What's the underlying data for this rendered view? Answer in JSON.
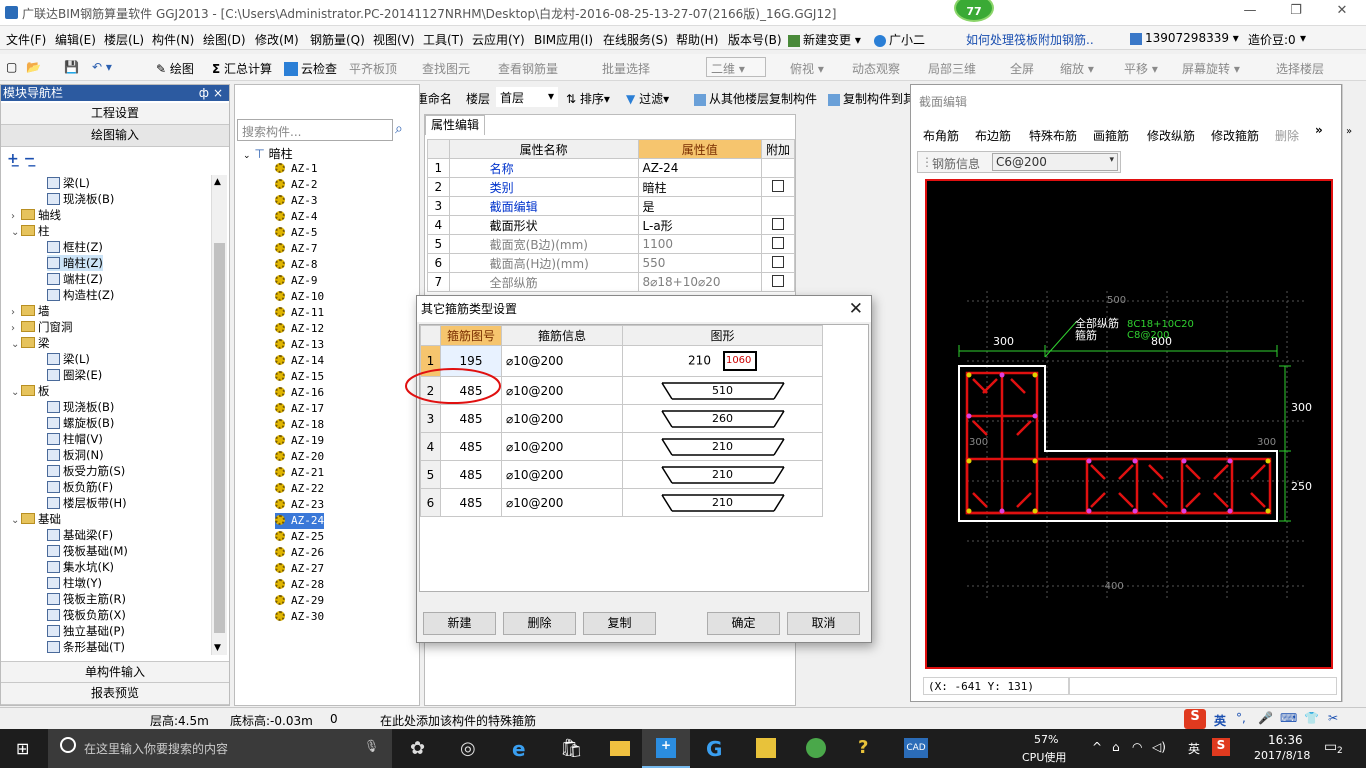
{
  "app": {
    "title": "广联达BIM钢筋算量软件 GGJ2013 - [C:\\Users\\Administrator.PC-20141127NRHM\\Desktop\\白龙村-2016-08-25-13-27-07(2166版)_16G.GGJ12]",
    "badge": "77"
  },
  "menu": [
    "文件(F)",
    "编辑(E)",
    "楼层(L)",
    "构件(N)",
    "绘图(D)",
    "修改(M)",
    "钢筋量(Q)",
    "视图(V)",
    "工具(T)",
    "云应用(Y)",
    "BIM应用(I)",
    "在线服务(S)",
    "帮助(H)",
    "版本号(B)",
    "新建变更",
    "广小二",
    "如何处理筏板附加钢筋..",
    "13907298339",
    "造价豆:0"
  ],
  "toolbar1": {
    "draw": "绘图",
    "sum": "汇总计算",
    "cloud_check": "云检查",
    "flat_top": "平齐板顶",
    "find": "查找图元",
    "view_steel": "查看钢筋量",
    "batch": "批量选择",
    "view_mode": "二维",
    "top_view": "俯视",
    "dynamic": "动态观察",
    "local3d": "局部三维",
    "fullscreen": "全屏",
    "zoom": "缩放",
    "pan": "平移",
    "rotate": "屏幕旋转",
    "select_floor": "选择楼层"
  },
  "toolbar2": {
    "new": "新建",
    "delete": "删除",
    "copy": "复制",
    "rename": "重命名",
    "floor_label": "楼层",
    "floor_value": "首层",
    "sort": "排序",
    "filter": "过滤",
    "copy_from_floor": "从其他楼层复制构件",
    "copy_to": "复制构件到其"
  },
  "left": {
    "header": "模块导航栏",
    "pin": "ф",
    "close": "×",
    "eng_settings": "工程设置",
    "draw_input": "绘图输入",
    "single_input": "单构件输入",
    "report": "报表预览",
    "tree": [
      {
        "t": "梁(L)",
        "lvl": 3,
        "icon": "beam"
      },
      {
        "t": "现浇板(B)",
        "lvl": 3,
        "icon": "slab"
      },
      {
        "t": "轴线",
        "lvl": 1,
        "icon": "folder",
        "exp": "›"
      },
      {
        "t": "柱",
        "lvl": 1,
        "icon": "folder",
        "exp": "⌄"
      },
      {
        "t": "框柱(Z)",
        "lvl": 3,
        "icon": "col"
      },
      {
        "t": "暗柱(Z)",
        "lvl": 3,
        "icon": "col",
        "sel": true
      },
      {
        "t": "端柱(Z)",
        "lvl": 3,
        "icon": "col"
      },
      {
        "t": "构造柱(Z)",
        "lvl": 3,
        "icon": "col"
      },
      {
        "t": "墙",
        "lvl": 1,
        "icon": "folder",
        "exp": "›"
      },
      {
        "t": "门窗洞",
        "lvl": 1,
        "icon": "folder",
        "exp": "›"
      },
      {
        "t": "梁",
        "lvl": 1,
        "icon": "folder",
        "exp": "⌄"
      },
      {
        "t": "梁(L)",
        "lvl": 3,
        "icon": "beam"
      },
      {
        "t": "圈梁(E)",
        "lvl": 3,
        "icon": "beam"
      },
      {
        "t": "板",
        "lvl": 1,
        "icon": "folder",
        "exp": "⌄"
      },
      {
        "t": "现浇板(B)",
        "lvl": 3,
        "icon": "slab"
      },
      {
        "t": "螺旋板(B)",
        "lvl": 3,
        "icon": "slab"
      },
      {
        "t": "柱帽(V)",
        "lvl": 3,
        "icon": "slab"
      },
      {
        "t": "板洞(N)",
        "lvl": 3,
        "icon": "slab"
      },
      {
        "t": "板受力筋(S)",
        "lvl": 3,
        "icon": "slab"
      },
      {
        "t": "板负筋(F)",
        "lvl": 3,
        "icon": "slab"
      },
      {
        "t": "楼层板带(H)",
        "lvl": 3,
        "icon": "slab"
      },
      {
        "t": "基础",
        "lvl": 1,
        "icon": "folder",
        "exp": "⌄"
      },
      {
        "t": "基础梁(F)",
        "lvl": 3,
        "icon": "beam"
      },
      {
        "t": "筏板基础(M)",
        "lvl": 3,
        "icon": "slab"
      },
      {
        "t": "集水坑(K)",
        "lvl": 3,
        "icon": "slab"
      },
      {
        "t": "柱墩(Y)",
        "lvl": 3,
        "icon": "col"
      },
      {
        "t": "筏板主筋(R)",
        "lvl": 3,
        "icon": "slab"
      },
      {
        "t": "筏板负筋(X)",
        "lvl": 3,
        "icon": "slab"
      },
      {
        "t": "独立基础(P)",
        "lvl": 3,
        "icon": "slab"
      },
      {
        "t": "条形基础(T)",
        "lvl": 3,
        "icon": "slab"
      }
    ]
  },
  "mid": {
    "search_placeholder": "搜索构件...",
    "root": "暗柱",
    "items": [
      "AZ-1",
      "AZ-2",
      "AZ-3",
      "AZ-4",
      "AZ-5",
      "AZ-7",
      "AZ-8",
      "AZ-9",
      "AZ-10",
      "AZ-11",
      "AZ-12",
      "AZ-13",
      "AZ-14",
      "AZ-15",
      "AZ-16",
      "AZ-17",
      "AZ-18",
      "AZ-19",
      "AZ-20",
      "AZ-21",
      "AZ-22",
      "AZ-23",
      "AZ-24",
      "AZ-25",
      "AZ-26",
      "AZ-27",
      "AZ-28",
      "AZ-29",
      "AZ-30"
    ],
    "selected": "AZ-24"
  },
  "props": {
    "tab": "属性编辑",
    "h_name": "属性名称",
    "h_value": "属性值",
    "h_extra": "附加",
    "rows": [
      {
        "n": "1",
        "name": "名称",
        "val": "AZ-24",
        "color": "blue",
        "chk": false
      },
      {
        "n": "2",
        "name": "类别",
        "val": "暗柱",
        "color": "blue",
        "chk": true
      },
      {
        "n": "3",
        "name": "截面编辑",
        "val": "是",
        "color": "blue",
        "chk": false
      },
      {
        "n": "4",
        "name": "截面形状",
        "val": "L-a形",
        "color": "normal",
        "chk": true
      },
      {
        "n": "5",
        "name": "截面宽(B边)(mm)",
        "val": "1100",
        "color": "gray",
        "chk": true
      },
      {
        "n": "6",
        "name": "截面高(H边)(mm)",
        "val": "550",
        "color": "gray",
        "chk": true
      },
      {
        "n": "7",
        "name": "全部纵筋",
        "val": "8⌀18+10⌀20",
        "color": "gray",
        "chk": true
      }
    ]
  },
  "dialog": {
    "title": "其它箍筋类型设置",
    "h_no": "箍筋图号",
    "h_info": "箍筋信息",
    "h_shape": "图形",
    "rows": [
      {
        "n": "1",
        "no": "195",
        "info": "⌀10@200",
        "a": "210",
        "b": "1060"
      },
      {
        "n": "2",
        "no": "485",
        "info": "⌀10@200",
        "a": "510"
      },
      {
        "n": "3",
        "no": "485",
        "info": "⌀10@200",
        "a": "260"
      },
      {
        "n": "4",
        "no": "485",
        "info": "⌀10@200",
        "a": "210"
      },
      {
        "n": "5",
        "no": "485",
        "info": "⌀10@200",
        "a": "210"
      },
      {
        "n": "6",
        "no": "485",
        "info": "⌀10@200",
        "a": "210"
      }
    ],
    "btn_new": "新建",
    "btn_delete": "删除",
    "btn_copy": "复制",
    "btn_ok": "确定",
    "btn_cancel": "取消"
  },
  "section": {
    "title": "截面编辑",
    "tools": [
      "布角筋",
      "布边筋",
      "特殊布筋",
      "画箍筋",
      "修改纵筋",
      "修改箍筋",
      "删除"
    ],
    "steel_label": "钢筋信息",
    "steel_value": "C6@200",
    "ann_all": "全部纵筋",
    "ann_all_val": "8C18+10C20",
    "ann_hoop": "箍筋",
    "ann_hoop_val": "C8@200",
    "dim_300a": "300",
    "dim_800": "800",
    "dim_300b": "300",
    "dim_250": "250",
    "grid_500": "500",
    "grid_300": "300",
    "grid_300b": "300",
    "grid_n400": "-400",
    "coords": "(X: -641 Y: 131)"
  },
  "status": {
    "floor_h": "层高:4.5m",
    "bottom_h": "底标高:-0.03m",
    "zero": "0",
    "hint": "在此处添加该构件的特殊箍筋"
  },
  "taskbar": {
    "search": "在这里输入你要搜索的内容",
    "cpu_pct": "57%",
    "cpu_label": "CPU使用",
    "lang": "英",
    "time": "16:36",
    "date": "2017/8/18",
    "notif": "2",
    "ime_lang": "英"
  }
}
